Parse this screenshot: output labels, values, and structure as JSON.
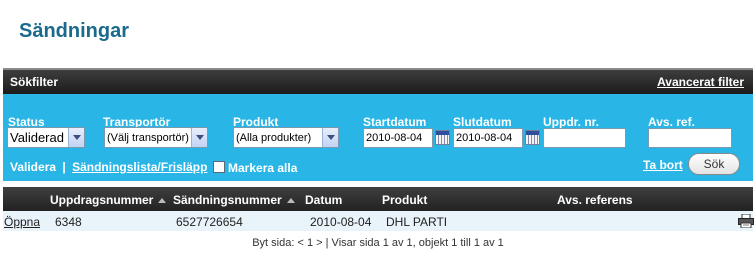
{
  "page": {
    "title": "Sändningar"
  },
  "filter": {
    "header_title": "Sökfilter",
    "advanced_link": "Avancerat filter",
    "fields": {
      "status": {
        "label": "Status",
        "value": "Validerad"
      },
      "transporter": {
        "label": "Transportör",
        "value": "(Välj transportör)"
      },
      "product": {
        "label": "Produkt",
        "value": "(Alla produkter)"
      },
      "start_date": {
        "label": "Startdatum",
        "value": "2010-08-04"
      },
      "end_date": {
        "label": "Slutdatum",
        "value": "2010-08-04"
      },
      "order_no": {
        "label": "Uppdr. nr.",
        "value": ""
      },
      "sender_ref": {
        "label": "Avs. ref.",
        "value": ""
      }
    },
    "links": {
      "validate": "Validera",
      "separator": "|",
      "shipping_list": "Sändningslista/Frisläpp"
    },
    "mark_all_label": "Markera alla",
    "remove_link": "Ta bort",
    "search_button": "Sök"
  },
  "table": {
    "columns": [
      "Uppdragsnummer",
      "Sändningsnummer",
      "Datum",
      "Produkt",
      "Avs. referens"
    ],
    "rows": [
      {
        "action": "Öppna",
        "order_no": "6348",
        "shipment_no": "6527726654",
        "date": "2010-08-04",
        "product": "DHL PARTI",
        "sender_ref": ""
      }
    ]
  },
  "pager": {
    "prefix": "Byt sida:",
    "prev": "<",
    "current": "1",
    "next": ">",
    "info": "| Visar sida 1 av 1, objekt 1 till 1 av 1"
  },
  "icons": {
    "calendar": "calendar-icon",
    "dropdown": "chevron-down-icon",
    "printer": "printer-icon",
    "sort": "sort-asc-icon"
  },
  "colors": {
    "title": "#1a6a8c",
    "filter_panel": "#29b6e6",
    "header_bar": "#222222",
    "row_bg": "#e9f3fa"
  }
}
